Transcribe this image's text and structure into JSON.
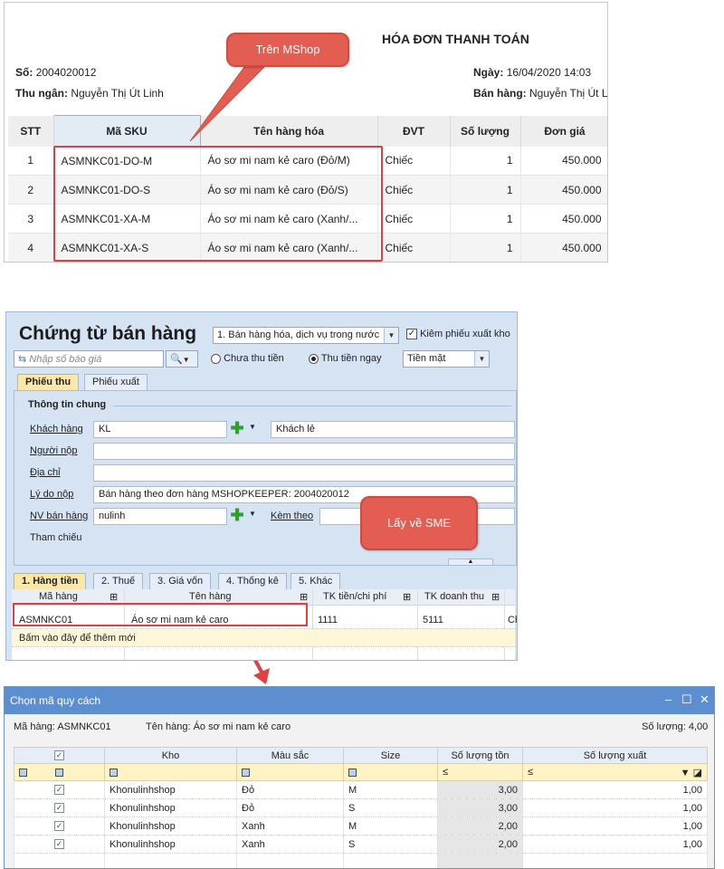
{
  "invoice": {
    "title": "HÓA ĐƠN THANH TOÁN",
    "so_label": "Số:",
    "so_value": "2004020012",
    "thu_ngan_label": "Thu ngân:",
    "thu_ngan_value": "Nguyễn Thị Út Linh",
    "ngay_label": "Ngày:",
    "ngay_value": "16/04/2020 14:03",
    "ban_hang_label": "Bán hàng:",
    "ban_hang_value": "Nguyễn Thị Út L",
    "columns": [
      "STT",
      "Mã SKU",
      "Tên hàng hóa",
      "ĐVT",
      "Số lượng",
      "Đơn giá"
    ],
    "rows": [
      {
        "stt": "1",
        "sku": "ASMNKC01-DO-M",
        "name": "Áo sơ mi nam kẻ caro (Đỏ/M)",
        "dvt": "Chiếc",
        "qty": "1",
        "price": "450.000"
      },
      {
        "stt": "2",
        "sku": "ASMNKC01-DO-S",
        "name": "Áo sơ mi nam kẻ caro (Đỏ/S)",
        "dvt": "Chiếc",
        "qty": "1",
        "price": "450.000"
      },
      {
        "stt": "3",
        "sku": "ASMNKC01-XA-M",
        "name": "Áo sơ mi nam kẻ caro (Xanh/...",
        "dvt": "Chiếc",
        "qty": "1",
        "price": "450.000"
      },
      {
        "stt": "4",
        "sku": "ASMNKC01-XA-S",
        "name": "Áo sơ mi nam kẻ caro (Xanh/...",
        "dvt": "Chiếc",
        "qty": "1",
        "price": "450.000"
      }
    ]
  },
  "callouts": {
    "mshop": "Trên MShop",
    "sme": "Lấy về SME"
  },
  "voucher": {
    "title": "Chứng từ bán hàng",
    "type_select": "1. Bán hàng hóa, dịch vụ trong nước",
    "kiem_phieu_label": "Kiêm phiếu xuất kho",
    "search_placeholder": "Nhập số báo giá",
    "chua_thu_tien": "Chưa thu tiền",
    "thu_tien_ngay": "Thu tiền ngay",
    "payment_method": "Tiền mặt",
    "tabs": [
      "Phiếu thu",
      "Phiếu xuất"
    ],
    "section_title": "Thông tin chung",
    "fields": {
      "khach_hang_label": "Khách hàng",
      "khach_hang_code": "KL",
      "khach_hang_name": "Khách lẻ",
      "nguoi_nop_label": "Người nộp",
      "dia_chi_label": "Địa chỉ",
      "ly_do_label": "Lý do nộp",
      "ly_do_value": "Bán hàng theo đơn hàng MSHOPKEEPER: 2004020012",
      "nv_ban_hang_label": "NV bán hàng",
      "nv_ban_hang_value": "nulinh",
      "kem_theo_label": "Kèm theo",
      "tham_chieu_label": "Tham chiếu"
    },
    "detail_tabs": [
      "1. Hàng tiền",
      "2. Thuế",
      "3. Giá vốn",
      "4. Thống kê",
      "5. Khác"
    ],
    "grid_columns": [
      "Mã hàng",
      "Tên hàng",
      "TK tiền/chi phí",
      "TK doanh thu"
    ],
    "grid_row": {
      "ma_hang": "ASMNKC01",
      "ten_hang": "Áo sơ mi nam kẻ caro",
      "tk_tien": "1111",
      "tk_doanh_thu": "5111",
      "extra": "Ch"
    },
    "add_row_hint": "Bấm vào đây để thêm mới"
  },
  "dialog": {
    "title": "Chọn mã quy cách",
    "ma_hang": "Mã hàng: ASMNKC01",
    "ten_hang": "Tên hàng: Áo sơ mi nam kẻ caro",
    "so_luong": "Số lượng: 4,00",
    "columns": [
      "Kho",
      "Màu sắc",
      "Size",
      "Số lượng tồn",
      "Số lượng xuất"
    ],
    "filter_le": "≤",
    "rows": [
      {
        "kho": "Khonulinhshop",
        "mau": "Đỏ",
        "size": "M",
        "ton": "3,00",
        "xuat": "1,00"
      },
      {
        "kho": "Khonulinhshop",
        "mau": "Đỏ",
        "size": "S",
        "ton": "3,00",
        "xuat": "1,00"
      },
      {
        "kho": "Khonulinhshop",
        "mau": "Xanh",
        "size": "M",
        "ton": "2,00",
        "xuat": "1,00"
      },
      {
        "kho": "Khonulinhshop",
        "mau": "Xanh",
        "size": "S",
        "ton": "2,00",
        "xuat": "1,00"
      }
    ]
  },
  "colors": {
    "callout": "#e35d52",
    "highlight_border": "#e0403f",
    "dialog_titlebar": "#5d8ed0"
  }
}
